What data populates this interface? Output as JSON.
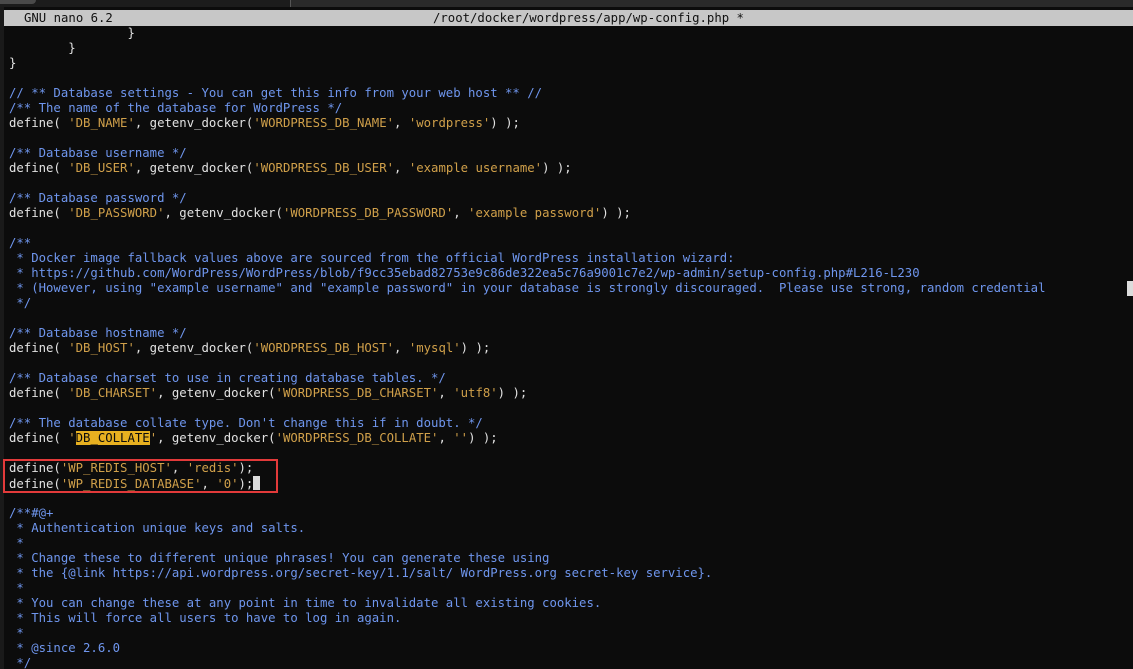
{
  "titlebar": {
    "app": "GNU nano 6.2",
    "file": "/root/docker/wordpress/app/wp-config.php *"
  },
  "editor": {
    "l01": {
      "text": "                }"
    },
    "l02": {
      "text": "        }"
    },
    "l03": {
      "text": "}"
    },
    "l05": {
      "text": "// ** Database settings - You can get this info from your web host ** //"
    },
    "l06": {
      "text": "/** The name of the database for WordPress */"
    },
    "l07": {
      "a": "define( ",
      "b": "'DB_NAME'",
      "c": ", getenv_docker(",
      "d": "'WORDPRESS_DB_NAME'",
      "e": ", ",
      "f": "'wordpress'",
      "g": ") );"
    },
    "l09": {
      "text": "/** Database username */"
    },
    "l10": {
      "a": "define( ",
      "b": "'DB_USER'",
      "c": ", getenv_docker(",
      "d": "'WORDPRESS_DB_USER'",
      "e": ", ",
      "f": "'example username'",
      "g": ") );"
    },
    "l12": {
      "text": "/** Database password */"
    },
    "l13": {
      "a": "define( ",
      "b": "'DB_PASSWORD'",
      "c": ", getenv_docker(",
      "d": "'WORDPRESS_DB_PASSWORD'",
      "e": ", ",
      "f": "'example password'",
      "g": ") );"
    },
    "l15": {
      "text": "/**"
    },
    "l16": {
      "text": " * Docker image fallback values above are sourced from the official WordPress installation wizard:"
    },
    "l17": {
      "text": " * https://github.com/WordPress/WordPress/blob/f9cc35ebad82753e9c86de322ea5c76a9001c7e2/wp-admin/setup-config.php#L216-L230"
    },
    "l18": {
      "text": " * (However, using \"example username\" and \"example password\" in your database is strongly discouraged.  Please use strong, random credential"
    },
    "l19": {
      "text": " */"
    },
    "l21": {
      "text": "/** Database hostname */"
    },
    "l22": {
      "a": "define( ",
      "b": "'DB_HOST'",
      "c": ", getenv_docker(",
      "d": "'WORDPRESS_DB_HOST'",
      "e": ", ",
      "f": "'mysql'",
      "g": ") );"
    },
    "l24": {
      "text": "/** Database charset to use in creating database tables. */"
    },
    "l25": {
      "a": "define( ",
      "b": "'DB_CHARSET'",
      "c": ", getenv_docker(",
      "d": "'WORDPRESS_DB_CHARSET'",
      "e": ", ",
      "f": "'utf8'",
      "g": ") );"
    },
    "l27": {
      "text": "/** The database collate type. Don't change this if in doubt. */"
    },
    "l28": {
      "a": "define( ",
      "q1": "'",
      "b": "DB_COLLATE",
      "q2": "'",
      "c": ", getenv_docker(",
      "d": "'WORDPRESS_DB_COLLATE'",
      "e": ", ",
      "f": "''",
      "g": ") );"
    },
    "l30": {
      "a": "define(",
      "b": "'WP_REDIS_HOST'",
      "c": ", ",
      "d": "'redis'",
      "e": ");"
    },
    "l31": {
      "a": "define(",
      "b": "'WP_REDIS_DATABASE'",
      "c": ", ",
      "d": "'0'",
      "e": ");"
    },
    "l33": {
      "text": "/**#@+"
    },
    "l34": {
      "text": " * Authentication unique keys and salts."
    },
    "l35": {
      "text": " *"
    },
    "l36": {
      "text": " * Change these to different unique phrases! You can generate these using"
    },
    "l37": {
      "text": " * the {@link https://api.wordpress.org/secret-key/1.1/salt/ WordPress.org secret-key service}."
    },
    "l38": {
      "text": " *"
    },
    "l39": {
      "text": " * You can change these at any point in time to invalidate all existing cookies."
    },
    "l40": {
      "text": " * This will force all users to have to log in again."
    },
    "l41": {
      "text": " *"
    },
    "l42": {
      "text": " * @since 2.6.0"
    },
    "l43": {
      "text": " */"
    }
  }
}
